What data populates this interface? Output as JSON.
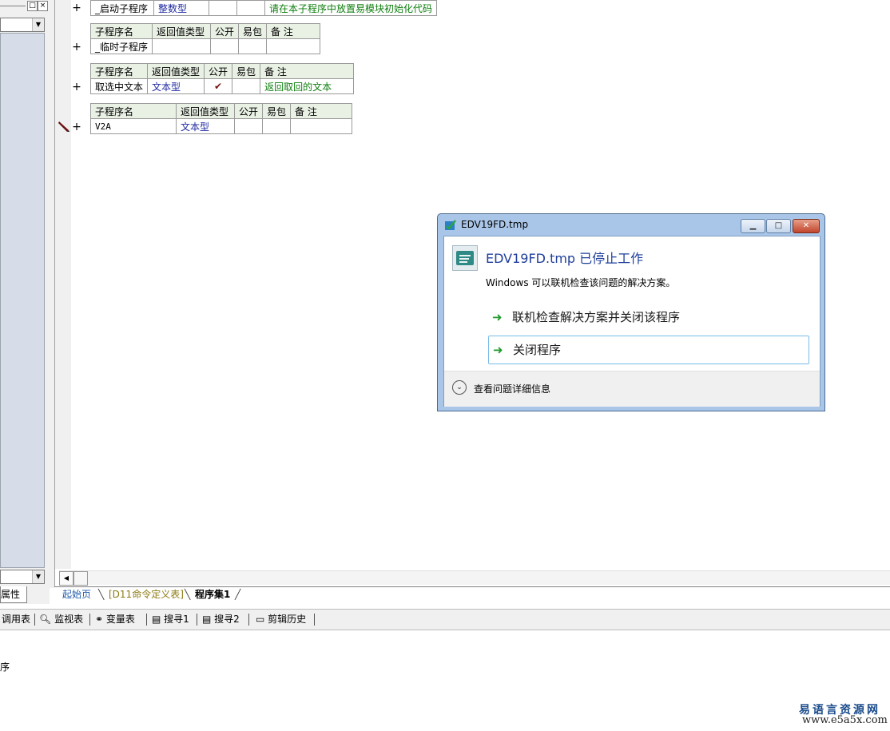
{
  "left_panel": {
    "tab_label": "属性"
  },
  "subroutines": [
    {
      "name": "_启动子程序",
      "return_type": "整数型",
      "public": "",
      "easy_pack": "",
      "note": "请在本子程序中放置易模块初始化代码",
      "has_header": false
    },
    {
      "headers": [
        "子程序名",
        "返回值类型",
        "公开",
        "易包",
        "备 注"
      ],
      "name": "_临时子程序",
      "return_type": "",
      "public": "",
      "easy_pack": "",
      "note": "",
      "has_header": true
    },
    {
      "headers": [
        "子程序名",
        "返回值类型",
        "公开",
        "易包",
        "备 注"
      ],
      "name": "取选中文本",
      "return_type": "文本型",
      "public": "✔",
      "easy_pack": "",
      "note": "返回取回的文本",
      "has_header": true
    },
    {
      "headers": [
        "子程序名",
        "返回值类型",
        "公开",
        "易包",
        "备 注"
      ],
      "name": "V2A",
      "return_type": "文本型",
      "public": "",
      "easy_pack": "",
      "note": "",
      "has_header": true
    }
  ],
  "doc_tabs": [
    {
      "label": "起始页",
      "color": "#1f5aa8"
    },
    {
      "label": "[D11命令定义表]",
      "color": "#8c7a12"
    },
    {
      "label": "程序集1",
      "color": "#000000"
    }
  ],
  "toolbar": {
    "items": [
      {
        "label": "调用表",
        "icon": ""
      },
      {
        "label": "监视表",
        "icon": "magnifier-icon"
      },
      {
        "label": "变量表",
        "icon": "glasses-icon"
      },
      {
        "label": "搜寻1",
        "icon": "search-doc-icon"
      },
      {
        "label": "搜寻2",
        "icon": "search-doc-icon"
      },
      {
        "label": "剪辑历史",
        "icon": "clipboard-icon"
      }
    ]
  },
  "output": {
    "text": "序"
  },
  "watermark": {
    "line1": "易语言资源网",
    "line2": "www.e5a5x.com"
  },
  "dialog": {
    "title": "EDV19FD.tmp",
    "heading": "EDV19FD.tmp 已停止工作",
    "message": "Windows 可以联机检查该问题的解决方案。",
    "option1": "联机检查解决方案并关闭该程序",
    "option2": "关闭程序",
    "details": "查看问题详细信息"
  }
}
